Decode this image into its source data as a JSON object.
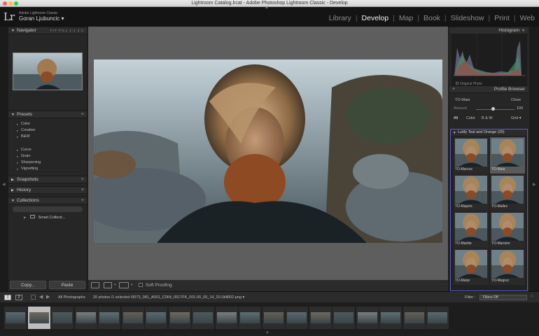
{
  "window": {
    "title": "Lightroom Catalog.lrcat - Adobe Photoshop Lightroom Classic - Develop"
  },
  "identity": {
    "logo": "Lr",
    "product": "Adobe Lightroom Classic",
    "user": "Goran Ljubuncic ▾"
  },
  "modules": [
    {
      "label": "Library",
      "active": false
    },
    {
      "label": "Develop",
      "active": true
    },
    {
      "label": "Map",
      "active": false
    },
    {
      "label": "Book",
      "active": false
    },
    {
      "label": "Slideshow",
      "active": false
    },
    {
      "label": "Print",
      "active": false
    },
    {
      "label": "Web",
      "active": false
    }
  ],
  "left": {
    "navigator": {
      "title": "Navigator",
      "zoom_options": "FIT  FILL  1:1  3:1"
    },
    "presets": {
      "title": "Presets",
      "items": [
        "Color",
        "Creative",
        "B&W",
        "Curve",
        "Grain",
        "Sharpening",
        "Vignetting"
      ]
    },
    "snapshots": {
      "title": "Snapshots"
    },
    "history": {
      "title": "History",
      "close": "×"
    },
    "collections": {
      "title": "Collections",
      "smart": "Smart Collecti..."
    },
    "copy_label": "Copy...",
    "paste_label": "Paste"
  },
  "toolbar": {
    "soft_proofing": "Soft Proofing"
  },
  "right": {
    "histogram": {
      "title": "Histogram",
      "original_photo": "Original Photo"
    },
    "profile_browser": {
      "title": "Profile Browser",
      "current": "TO-Maia",
      "close": "Close",
      "amount_label": "Amount",
      "amount_value": "100",
      "tabs": [
        "All",
        "Color",
        "B & W",
        "Grid ▾"
      ],
      "group": "Lutify Teal and Orange (20)",
      "profiles": [
        "TO-Macrux",
        "TO-Maia",
        "TO-Majoris",
        "TO-Mallex",
        "TO-Marble",
        "TO-Marston",
        "TO-Matar",
        "TO-Megrez"
      ],
      "selected": "TO-Maia"
    }
  },
  "filmbar": {
    "page1": "1",
    "page2": "2",
    "source": "All Photographs",
    "info": "20 photos /1 selected /0073_081_A001_C064_0517FK_001.00_00_14_20.Still002.png ▾",
    "filter_label": "Filter :",
    "filter_value": "Filters Off"
  },
  "filmstrip": {
    "count": 19,
    "selected_index": 1
  },
  "colors": {
    "accent_border": "#5b5bd1",
    "panel": "#262626",
    "background": "#1e1e1e"
  }
}
